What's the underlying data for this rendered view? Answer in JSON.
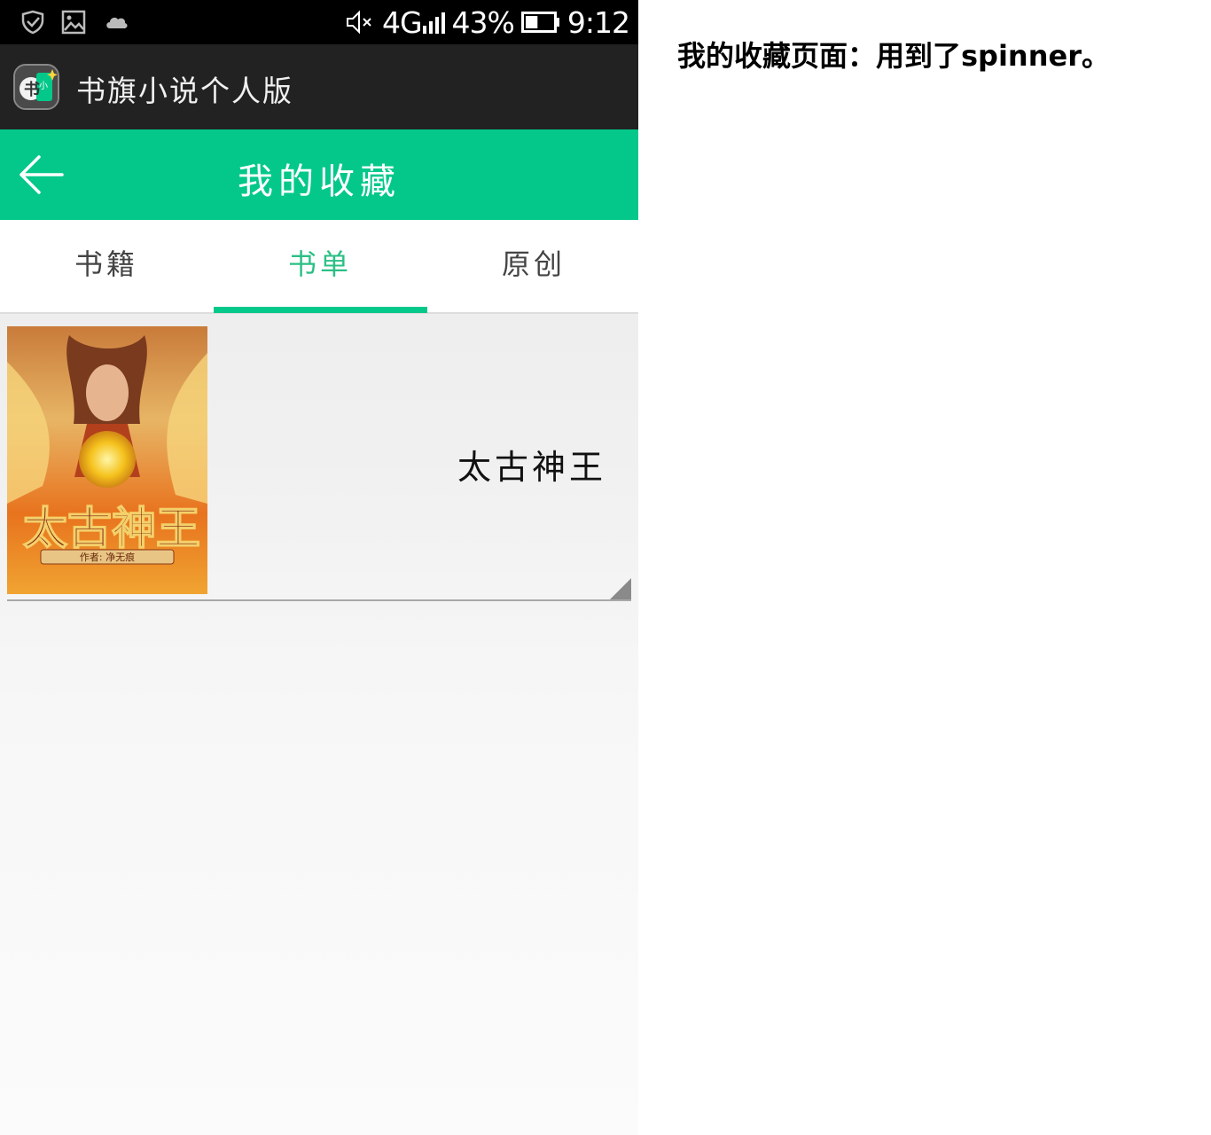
{
  "status_bar": {
    "icons": [
      "shield-check-icon",
      "image-icon",
      "cloud-icon"
    ],
    "mute_icon": "speaker-mute-icon",
    "network": "4G",
    "battery_percent": "43%",
    "battery_level": 0.43,
    "time": "9:12"
  },
  "app_bar": {
    "title": "书旗小说个人版",
    "logo_text": "书旗小说"
  },
  "header": {
    "title": "我的收藏",
    "back_icon": "arrow-left-icon"
  },
  "tabs": [
    {
      "label": "书籍",
      "active": false
    },
    {
      "label": "书单",
      "active": true
    },
    {
      "label": "原创",
      "active": false
    }
  ],
  "book": {
    "title": "太古神王",
    "cover_title": "太古神王",
    "cover_subtitle": "作者: 净无痕"
  },
  "annotation": "我的收藏页面：用到了spinner。",
  "colors": {
    "accent": "#03c88a",
    "tab_active": "#2bbf85",
    "app_bar": "#222222",
    "status_bar": "#000000"
  }
}
